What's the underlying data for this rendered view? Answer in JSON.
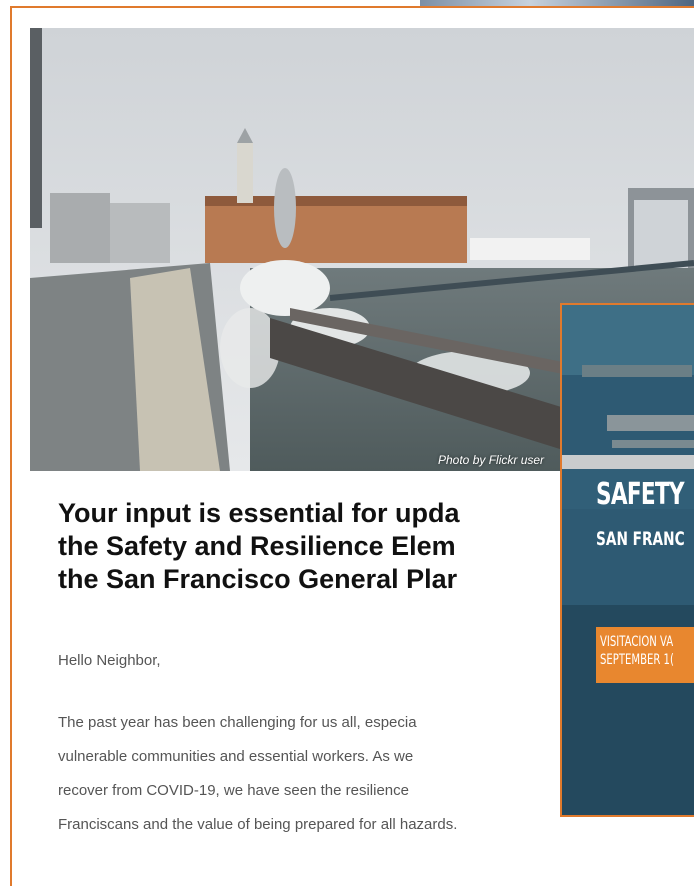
{
  "hero": {
    "photo_credit": "Photo by Flickr user",
    "image_icon": "photo-image"
  },
  "article": {
    "headline_lines": [
      "Your input is essential for upda",
      "the Safety and Resilience Elem",
      "the San Francisco General Plar"
    ],
    "greeting": "Hello Neighbor,",
    "paragraph_lines": [
      "The past year has been challenging for us all, especia",
      "vulnerable communities and essential workers. As we",
      "recover from COVID-19, we have seen the resilience",
      "Franciscans and the value of being prepared for all hazards."
    ]
  },
  "poster": {
    "title": "SAFETY",
    "subtitle": "SAN FRANC",
    "badge_lines": [
      "VISITACION VA",
      "SEPTEMBER 1("
    ],
    "badge_color": "#e8872f"
  },
  "colors": {
    "accent": "#e07a2d",
    "headline": "#111111",
    "body_text": "#555555"
  }
}
